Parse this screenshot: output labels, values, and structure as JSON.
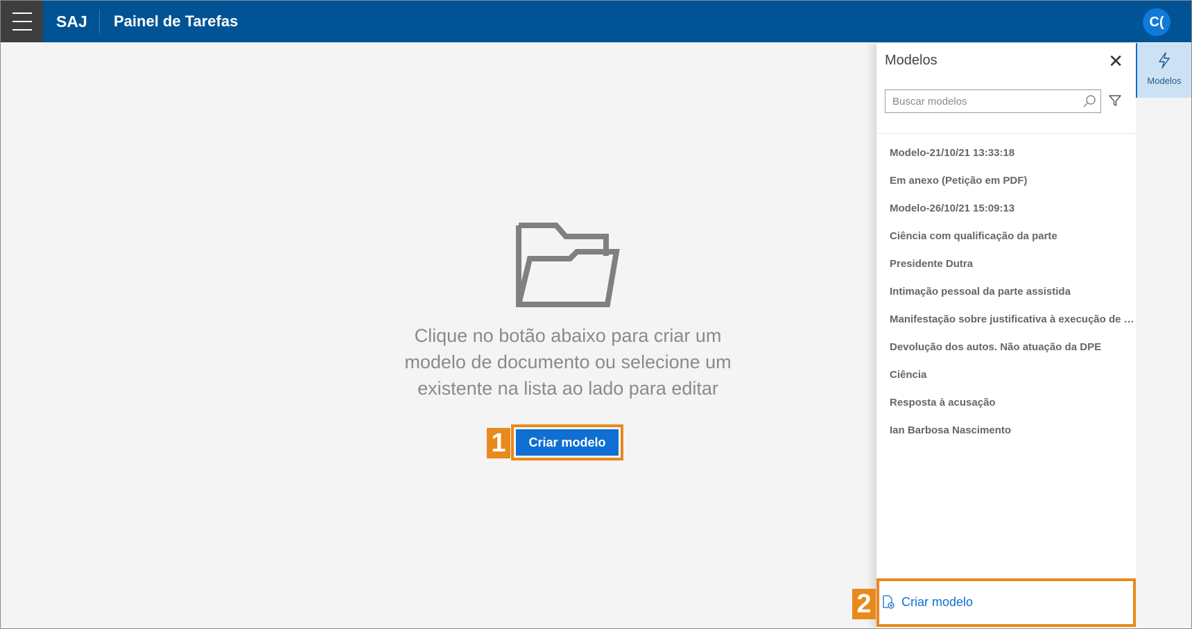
{
  "topbar": {
    "brand": "SAJ",
    "title": "Painel de Tarefas",
    "avatar_initials": "C("
  },
  "empty_state": {
    "icon": "open-folder-icon",
    "message": "Clique no botão abaixo para criar um modelo de documento ou selecione um existente na lista ao lado para editar",
    "button_label": "Criar modelo",
    "step_badge": "1"
  },
  "panel": {
    "title": "Modelos",
    "search_placeholder": "Buscar modelos",
    "items": [
      "Modelo-21/10/21 13:33:18",
      "Em anexo (Petição em PDF)",
      "Modelo-26/10/21 15:09:13",
      "Ciência com qualificação da parte",
      "Presidente Dutra",
      "Intimação pessoal da parte assistida",
      "Manifestação sobre justificativa à execução de alimentos",
      "Devolução dos autos. Não atuação da DPE",
      "Ciência",
      "Resposta à acusação",
      "Ian Barbosa Nascimento"
    ],
    "footer_button_label": "Criar modelo",
    "footer_step_badge": "2"
  },
  "rail": {
    "tab_label": "Modelos",
    "tab_icon": "lightning-icon"
  },
  "colors": {
    "topbar": "#005395",
    "primary": "#0f6fd2",
    "highlight": "#e8891c"
  }
}
